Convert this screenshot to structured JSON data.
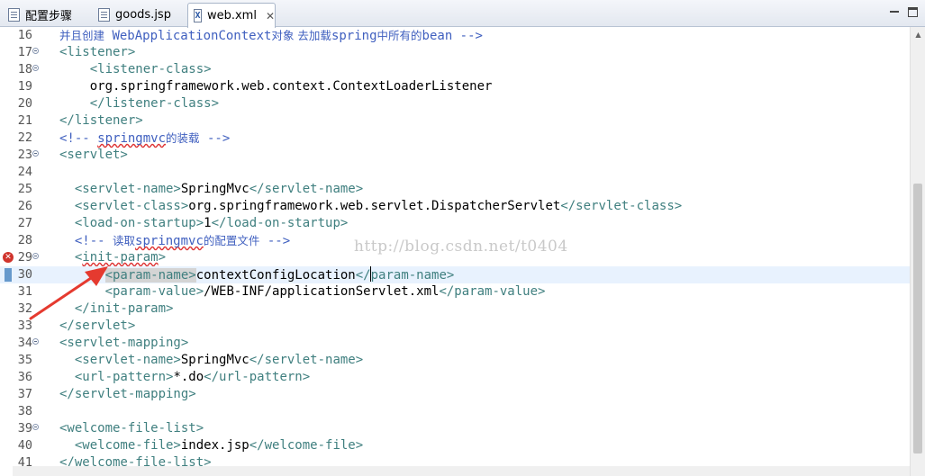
{
  "tabs": [
    {
      "label": "配置步骤",
      "icon": "text-file-icon",
      "active": false
    },
    {
      "label": "goods.jsp",
      "icon": "jsp-file-icon",
      "active": false
    },
    {
      "label": "web.xml",
      "icon": "xml-file-icon",
      "active": true,
      "close": "✕"
    }
  ],
  "editor": {
    "watermark": "http://blog.csdn.net/t0404",
    "lines": [
      {
        "n": "16",
        "parts": [
          [
            "c",
            "并且创建"
          ],
          [
            "m",
            " WebApplicationContext"
          ],
          [
            "c",
            "对象 去加载"
          ],
          [
            "m",
            "spring"
          ],
          [
            "c",
            "中所有的"
          ],
          [
            "m",
            "bean -->"
          ]
        ]
      },
      {
        "n": "17",
        "fold": true,
        "parts": [
          [
            "t",
            "<listener>"
          ]
        ]
      },
      {
        "n": "18",
        "fold": true,
        "parts": [
          [
            "x",
            "    "
          ],
          [
            "t",
            "<listener-class>"
          ]
        ]
      },
      {
        "n": "19",
        "parts": [
          [
            "x",
            "    org.springframework.web.context.ContextLoaderListener"
          ]
        ]
      },
      {
        "n": "20",
        "parts": [
          [
            "x",
            "    "
          ],
          [
            "t",
            "</listener-class>"
          ]
        ]
      },
      {
        "n": "21",
        "parts": [
          [
            "t",
            "</listener>"
          ]
        ]
      },
      {
        "n": "22",
        "parts": [
          [
            "m",
            "<!-- "
          ],
          [
            "ms",
            "springmvc"
          ],
          [
            "c",
            "的装载"
          ],
          [
            "m",
            " -->"
          ]
        ]
      },
      {
        "n": "23",
        "fold": true,
        "parts": [
          [
            "t",
            "<servlet>"
          ]
        ]
      },
      {
        "n": "24",
        "parts": []
      },
      {
        "n": "25",
        "parts": [
          [
            "x",
            "  "
          ],
          [
            "t",
            "<servlet-name>"
          ],
          [
            "x",
            "SpringMvc"
          ],
          [
            "t",
            "</servlet-name>"
          ]
        ]
      },
      {
        "n": "26",
        "parts": [
          [
            "x",
            "  "
          ],
          [
            "t",
            "<servlet-class>"
          ],
          [
            "x",
            "org.springframework.web.servlet.DispatcherServlet"
          ],
          [
            "t",
            "</servlet-class>"
          ]
        ]
      },
      {
        "n": "27",
        "parts": [
          [
            "x",
            "  "
          ],
          [
            "t",
            "<load-on-startup>"
          ],
          [
            "x",
            "1"
          ],
          [
            "t",
            "</load-on-startup>"
          ]
        ]
      },
      {
        "n": "28",
        "parts": [
          [
            "x",
            "  "
          ],
          [
            "m",
            "<!-- "
          ],
          [
            "c",
            "读取"
          ],
          [
            "ms",
            "springmvc"
          ],
          [
            "c",
            "的配置文件"
          ],
          [
            "m",
            " -->"
          ]
        ]
      },
      {
        "n": "29",
        "fold": true,
        "error": true,
        "parts": [
          [
            "x",
            "  "
          ],
          [
            "t",
            "<"
          ],
          [
            "ts",
            "init-param"
          ],
          [
            "t",
            ">"
          ]
        ]
      },
      {
        "n": "30",
        "current": true,
        "parts": [
          [
            "x",
            "      "
          ],
          [
            "th",
            "<param-name>"
          ],
          [
            "x",
            "contextConfigLocation"
          ],
          [
            "t",
            "</"
          ],
          [
            "caret",
            ""
          ],
          [
            "t",
            "param-name>"
          ]
        ]
      },
      {
        "n": "31",
        "parts": [
          [
            "x",
            "      "
          ],
          [
            "t",
            "<param-value>"
          ],
          [
            "x",
            "/WEB-INF/applicationServlet.xml"
          ],
          [
            "t",
            "</param-value>"
          ]
        ]
      },
      {
        "n": "32",
        "parts": [
          [
            "x",
            "  "
          ],
          [
            "t",
            "</init-param>"
          ]
        ]
      },
      {
        "n": "33",
        "parts": [
          [
            "t",
            "</servlet>"
          ]
        ]
      },
      {
        "n": "34",
        "fold": true,
        "parts": [
          [
            "t",
            "<servlet-mapping>"
          ]
        ]
      },
      {
        "n": "35",
        "parts": [
          [
            "x",
            "  "
          ],
          [
            "t",
            "<servlet-name>"
          ],
          [
            "x",
            "SpringMvc"
          ],
          [
            "t",
            "</servlet-name>"
          ]
        ]
      },
      {
        "n": "36",
        "parts": [
          [
            "x",
            "  "
          ],
          [
            "t",
            "<url-pattern>"
          ],
          [
            "x",
            "*.do"
          ],
          [
            "t",
            "</url-pattern>"
          ]
        ]
      },
      {
        "n": "37",
        "parts": [
          [
            "t",
            "</servlet-mapping>"
          ]
        ]
      },
      {
        "n": "38",
        "parts": []
      },
      {
        "n": "39",
        "fold": true,
        "parts": [
          [
            "t",
            "<welcome-file-list>"
          ]
        ]
      },
      {
        "n": "40",
        "parts": [
          [
            "x",
            "  "
          ],
          [
            "t",
            "<welcome-file>"
          ],
          [
            "x",
            "index.jsp"
          ],
          [
            "t",
            "</welcome-file>"
          ]
        ]
      },
      {
        "n": "41",
        "parts": [
          [
            "t",
            "</welcome-file-list>"
          ]
        ]
      }
    ]
  },
  "colors": {
    "tag": "#3f7f7f",
    "comment": "#3f5fbf",
    "text": "#000000",
    "current_line": "#e8f2fe",
    "error": "#d0342c",
    "annotation_arrow": "#e53a2f"
  }
}
